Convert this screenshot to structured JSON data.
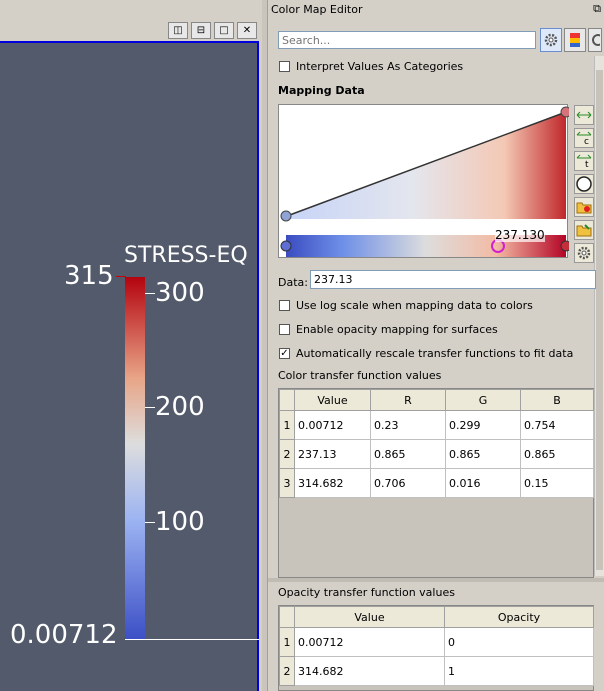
{
  "view_toolbar": {
    "buttons": [
      "◫",
      "⊟",
      "□",
      "✕"
    ]
  },
  "scalar_bar": {
    "title": "STRESS-EQ",
    "max_label": "315",
    "min_label": "0.00712",
    "ticks": [
      "300",
      "200",
      "100"
    ]
  },
  "panel": {
    "title": "Color Map Editor",
    "float_icon": "⧉",
    "search_placeholder": "Search...",
    "interpret_categories": {
      "label": "Interpret Values As Categories",
      "checked": false
    },
    "mapping_data_label": "Mapping Data",
    "current_value_label": "237.130",
    "data": {
      "label": "Data:",
      "value": "237.13"
    },
    "log_scale": {
      "label": "Use log scale when mapping data to colors",
      "checked": false
    },
    "opacity_mapping": {
      "label": "Enable opacity mapping for surfaces",
      "checked": false
    },
    "auto_rescale": {
      "label": "Automatically rescale transfer functions to fit data",
      "checked": true
    },
    "color_tf": {
      "label": "Color transfer function values",
      "headers": [
        "Value",
        "R",
        "G",
        "B"
      ],
      "rows": [
        {
          "n": "1",
          "cells": [
            "0.00712",
            "0.23",
            "0.299",
            "0.754"
          ]
        },
        {
          "n": "2",
          "cells": [
            "237.13",
            "0.865",
            "0.865",
            "0.865"
          ]
        },
        {
          "n": "3",
          "cells": [
            "314.682",
            "0.706",
            "0.016",
            "0.15"
          ]
        }
      ]
    },
    "opacity_tf": {
      "label": "Opacity transfer function values",
      "headers": [
        "Value",
        "Opacity"
      ],
      "rows": [
        {
          "n": "1",
          "cells": [
            "0.00712",
            "0"
          ]
        },
        {
          "n": "2",
          "cells": [
            "314.682",
            "1"
          ]
        }
      ]
    }
  }
}
